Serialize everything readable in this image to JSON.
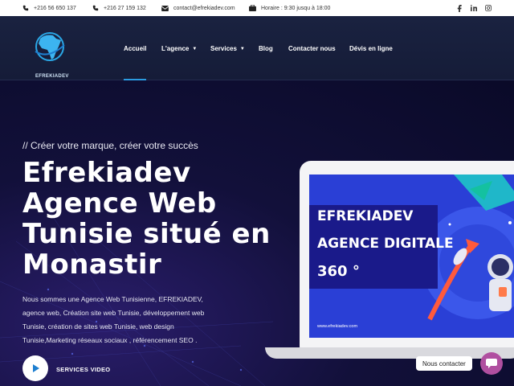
{
  "topbar": {
    "phone1": "+216 56 650 137",
    "phone2": "+216 27 159 132",
    "email": "contact@efrekiadev.com",
    "hours": "Horaire : 9:30 jusqu à 18:00",
    "social": [
      "facebook-icon",
      "linkedin-icon",
      "instagram-icon"
    ]
  },
  "header": {
    "logo_text": "EFREKIADEV",
    "nav": [
      {
        "label": "Accueil",
        "dropdown": false,
        "active": true
      },
      {
        "label": "L'agence",
        "dropdown": true
      },
      {
        "label": "Services",
        "dropdown": true
      },
      {
        "label": "Blog",
        "dropdown": false
      },
      {
        "label": "Contacter nous",
        "dropdown": false
      },
      {
        "label": "Dévis en ligne",
        "dropdown": false
      }
    ],
    "caret": "▼"
  },
  "hero": {
    "tagline": "// Créer votre marque, créer votre succès",
    "title_lines": [
      "Efrekiadev",
      "Agence Web",
      "Tunisie situé en",
      "Monastir"
    ],
    "description": "Nous sommes une Agence Web  Tunisienne, EFREKIADEV, agence web, Création site web Tunisie, développement web Tunisie, création de sites web  Tunisie, web design Tunisie,Marketing réseaux sociaux , référencement SEO .",
    "video_label": "SERVICES VIDEO"
  },
  "screen": {
    "line1": "EFREKIADEV",
    "line2": "AGENCE DIGITALE",
    "line3": "360 °",
    "url": "www.efrekiadev.com"
  },
  "chat": {
    "label": "Nous contacter"
  },
  "colors": {
    "accent": "#2b9be0",
    "hero_bg": "#0c0c2e",
    "screen_bg": "#2a3fd6",
    "chat": "#b04fa0"
  }
}
